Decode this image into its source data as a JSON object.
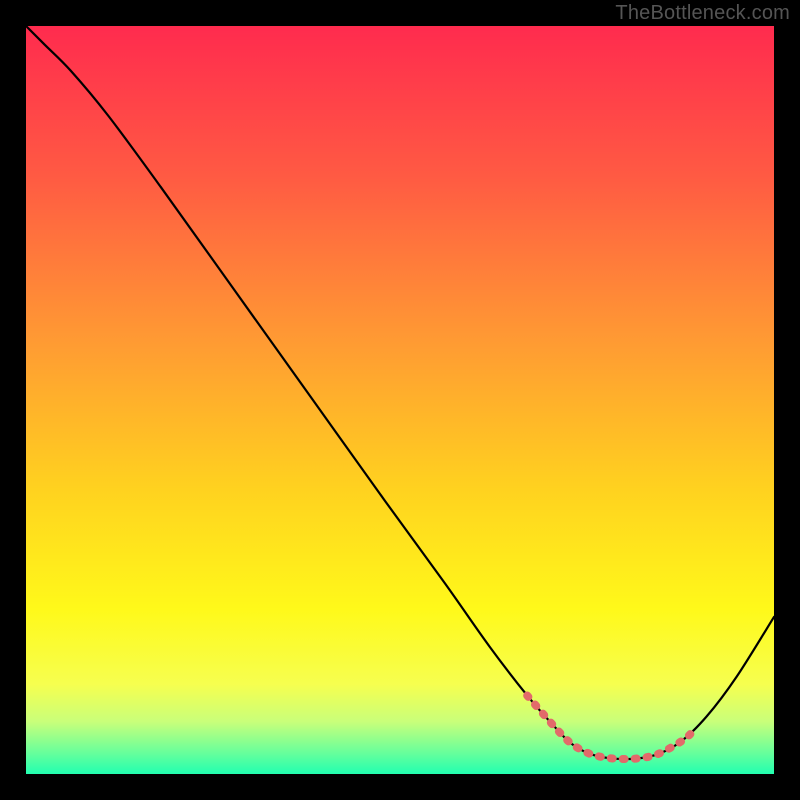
{
  "watermark": "TheBottleneck.com",
  "chart_data": {
    "type": "line",
    "title": "",
    "xlabel": "",
    "ylabel": "",
    "xlim": [
      0,
      100
    ],
    "ylim": [
      0,
      100
    ],
    "grid": false,
    "legend": false,
    "gradient_stops": [
      {
        "offset": 0.0,
        "color": "#ff2b4e"
      },
      {
        "offset": 0.2,
        "color": "#ff5a43"
      },
      {
        "offset": 0.42,
        "color": "#ff9a33"
      },
      {
        "offset": 0.62,
        "color": "#ffd21f"
      },
      {
        "offset": 0.78,
        "color": "#fff91a"
      },
      {
        "offset": 0.88,
        "color": "#f6ff4f"
      },
      {
        "offset": 0.93,
        "color": "#c9ff7a"
      },
      {
        "offset": 0.97,
        "color": "#6bff9a"
      },
      {
        "offset": 1.0,
        "color": "#22ffb0"
      }
    ],
    "series": [
      {
        "name": "curve",
        "stroke": "#000000",
        "stroke_width": 2.2,
        "points": [
          {
            "x": 0.0,
            "y": 100.0
          },
          {
            "x": 2.5,
            "y": 97.5
          },
          {
            "x": 6.0,
            "y": 94.0
          },
          {
            "x": 11.0,
            "y": 88.0
          },
          {
            "x": 18.0,
            "y": 78.5
          },
          {
            "x": 28.0,
            "y": 64.5
          },
          {
            "x": 38.0,
            "y": 50.5
          },
          {
            "x": 48.0,
            "y": 36.5
          },
          {
            "x": 56.0,
            "y": 25.5
          },
          {
            "x": 62.0,
            "y": 17.0
          },
          {
            "x": 67.0,
            "y": 10.5
          },
          {
            "x": 70.5,
            "y": 6.5
          },
          {
            "x": 73.0,
            "y": 4.0
          },
          {
            "x": 76.0,
            "y": 2.5
          },
          {
            "x": 80.0,
            "y": 2.0
          },
          {
            "x": 84.0,
            "y": 2.5
          },
          {
            "x": 87.5,
            "y": 4.3
          },
          {
            "x": 91.0,
            "y": 7.7
          },
          {
            "x": 95.0,
            "y": 13.0
          },
          {
            "x": 100.0,
            "y": 21.0
          }
        ]
      },
      {
        "name": "highlight",
        "stroke": "#e26a6a",
        "stroke_width": 8,
        "dash": [
          2,
          10
        ],
        "points": [
          {
            "x": 67.0,
            "y": 10.5
          },
          {
            "x": 70.5,
            "y": 6.5
          },
          {
            "x": 73.0,
            "y": 4.0
          },
          {
            "x": 76.0,
            "y": 2.5
          },
          {
            "x": 80.0,
            "y": 2.0
          },
          {
            "x": 84.0,
            "y": 2.5
          },
          {
            "x": 87.5,
            "y": 4.3
          },
          {
            "x": 89.0,
            "y": 5.5
          }
        ]
      }
    ]
  }
}
